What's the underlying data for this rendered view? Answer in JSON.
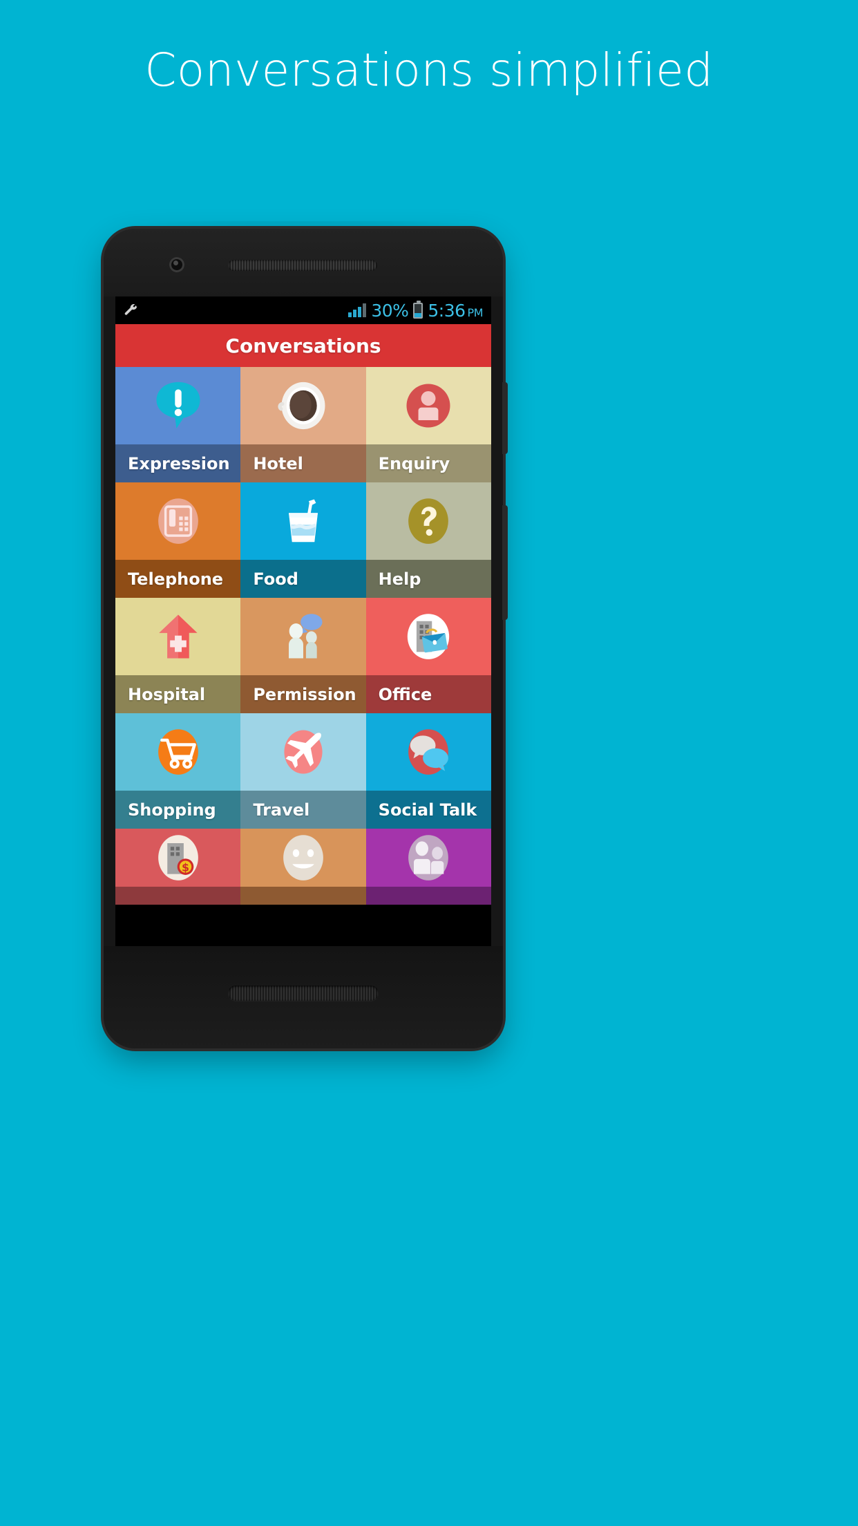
{
  "headline": "Conversations simplified",
  "background_color": "#00b4d2",
  "statusbar": {
    "settings_icon": "wrench-icon",
    "signal_icon": "signal-bars-icon",
    "battery_percent": "30%",
    "battery_icon": "battery-icon",
    "time": "5:36",
    "meridiem": "PM"
  },
  "appbar": {
    "title": "Conversations",
    "color": "#d93434"
  },
  "tiles": [
    {
      "label": "Expression",
      "icon": "exclamation-speech-bubble-icon",
      "top_color": "#5b8bd4",
      "label_color": "#3d5d8e"
    },
    {
      "label": "Hotel",
      "icon": "coffee-cup-icon",
      "top_color": "#e2aa86",
      "label_color": "#9b6b4e"
    },
    {
      "label": "Enquiry",
      "icon": "person-info-icon",
      "top_color": "#e8dfae",
      "label_color": "#9a9370"
    },
    {
      "label": "Telephone",
      "icon": "telephone-icon",
      "top_color": "#dd7b2c",
      "label_color": "#8f4d16"
    },
    {
      "label": "Food",
      "icon": "drink-cup-icon",
      "top_color": "#09a9dc",
      "label_color": "#0b6f8c"
    },
    {
      "label": "Help",
      "icon": "question-mark-icon",
      "top_color": "#b9bca2",
      "label_color": "#6b6f58"
    },
    {
      "label": "Hospital",
      "icon": "hospital-arrow-cross-icon",
      "top_color": "#e2d896",
      "label_color": "#8c8455"
    },
    {
      "label": "Permission",
      "icon": "two-people-speech-icon",
      "top_color": "#d9975f",
      "label_color": "#8f5a32"
    },
    {
      "label": "Office",
      "icon": "office-building-briefcase-icon",
      "top_color": "#ef5f5c",
      "label_color": "#9e3a3a"
    },
    {
      "label": "Shopping",
      "icon": "shopping-cart-icon",
      "top_color": "#5ec0d8",
      "label_color": "#347f8f"
    },
    {
      "label": "Travel",
      "icon": "airplane-icon",
      "top_color": "#9ed4e6",
      "label_color": "#5e8c9b"
    },
    {
      "label": "Social Talk",
      "icon": "two-speech-bubbles-icon",
      "top_color": "#10abdc",
      "label_color": "#0d7090"
    },
    {
      "label": "",
      "icon": "bank-money-icon",
      "top_color": "#d9595c",
      "label_color": "#8e3a3d"
    },
    {
      "label": "",
      "icon": "smiley-face-icon",
      "top_color": "#d8945a",
      "label_color": "#8e5a32"
    },
    {
      "label": "",
      "icon": "group-people-icon",
      "top_color": "#a434ab",
      "label_color": "#6c2272"
    }
  ]
}
